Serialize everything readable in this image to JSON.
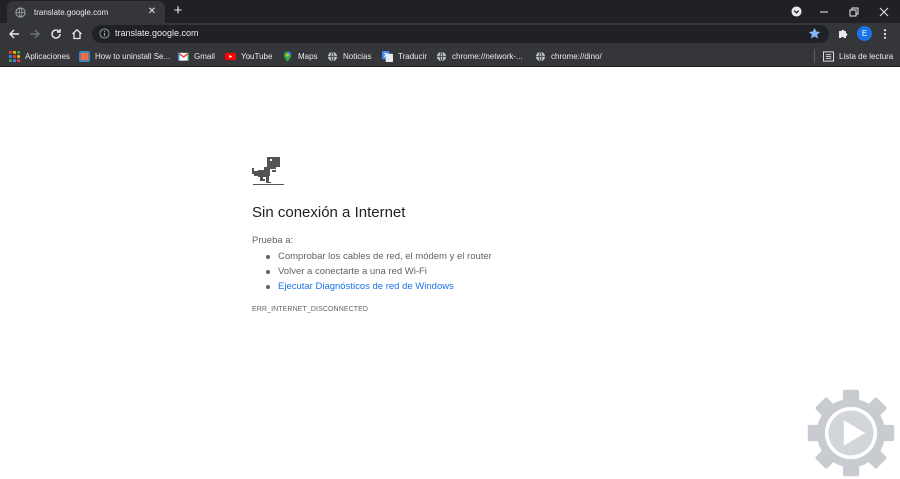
{
  "tab": {
    "title": "translate.google.com",
    "close_glyph": "✕",
    "new_tab_glyph": "+"
  },
  "toolbar": {
    "url": "translate.google.com",
    "avatar_letter": "E"
  },
  "bookmarks": [
    {
      "label": "Aplicaciones",
      "icon": "apps-grid-icon"
    },
    {
      "label": "How to uninstall Se...",
      "icon": "site-favicon"
    },
    {
      "label": "Gmail",
      "icon": "gmail-icon"
    },
    {
      "label": "YouTube",
      "icon": "youtube-icon"
    },
    {
      "label": "Maps",
      "icon": "maps-pin-icon"
    },
    {
      "label": "Noticias",
      "icon": "globe-icon"
    },
    {
      "label": "Traducir",
      "icon": "translate-icon"
    },
    {
      "label": "chrome://network-...",
      "icon": "globe-icon"
    },
    {
      "label": "chrome://dino/",
      "icon": "globe-icon"
    }
  ],
  "reading_list": {
    "label": "Lista de lectura"
  },
  "error_page": {
    "title": "Sin conexión a Internet",
    "try_label": "Prueba a:",
    "suggestions": [
      "Comprobar los cables de red, el módem y el router",
      "Volver a conectarte a una red Wi-Fi",
      "Ejecutar Diagnósticos de red de Windows"
    ],
    "error_code": "ERR_INTERNET_DISCONNECTED"
  },
  "colors": {
    "chrome_dark": "#202124",
    "toolbar": "#35363a",
    "link": "#1a73e8",
    "text_secondary": "#5f6368"
  }
}
